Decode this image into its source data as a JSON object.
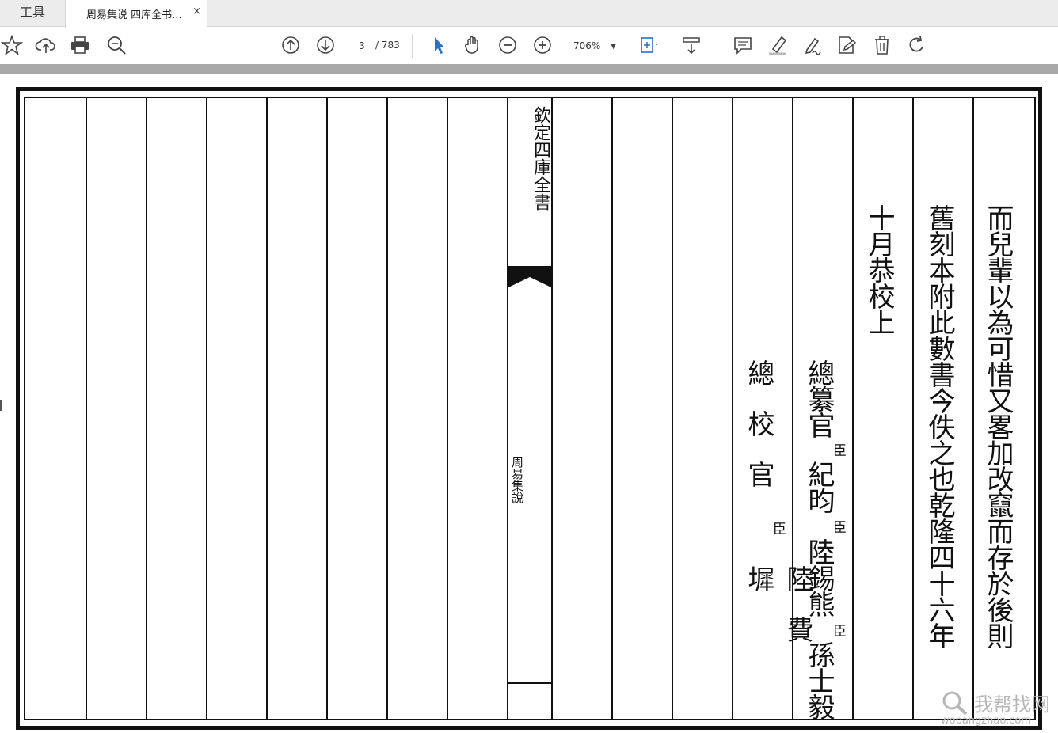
{
  "tabs": {
    "tools_label": "工具",
    "document_title": "周易集说 四库全书...",
    "close_glyph": "×"
  },
  "toolbar": {
    "page_current": "3",
    "page_total": "/ 783",
    "zoom": "706%",
    "icons": [
      "star-icon",
      "cloud-upload-icon",
      "print-icon",
      "zoom-search-icon",
      "page-up-icon",
      "page-down-icon",
      "select-arrow-icon",
      "hand-icon",
      "zoom-out-icon",
      "zoom-in-icon",
      "fit-page-icon",
      "scroll-mode-icon",
      "comment-icon",
      "highlight-icon",
      "sign-icon",
      "stamp-icon",
      "delete-icon",
      "rotate-icon"
    ]
  },
  "document": {
    "center_title": "欽定四庫全書",
    "center_book_name": "周易集說",
    "columns": {
      "col1": "而兒輩以為可惜又畧加改竄而存於後則",
      "col2": "舊刻本附此數書今佚之也乾隆四十六年",
      "col3": "十月恭校上",
      "col4_title": "總纂官",
      "col4_names": [
        "紀昀",
        "陸錫熊",
        "孫士毅"
      ],
      "col4_marks": [
        "臣",
        "臣",
        "臣"
      ],
      "col5_title": "總校官",
      "col5_mark": "臣",
      "col5_name": "陸費墀"
    }
  },
  "watermark": {
    "main": "我帮找网",
    "sub": "wobangzhao.com"
  }
}
